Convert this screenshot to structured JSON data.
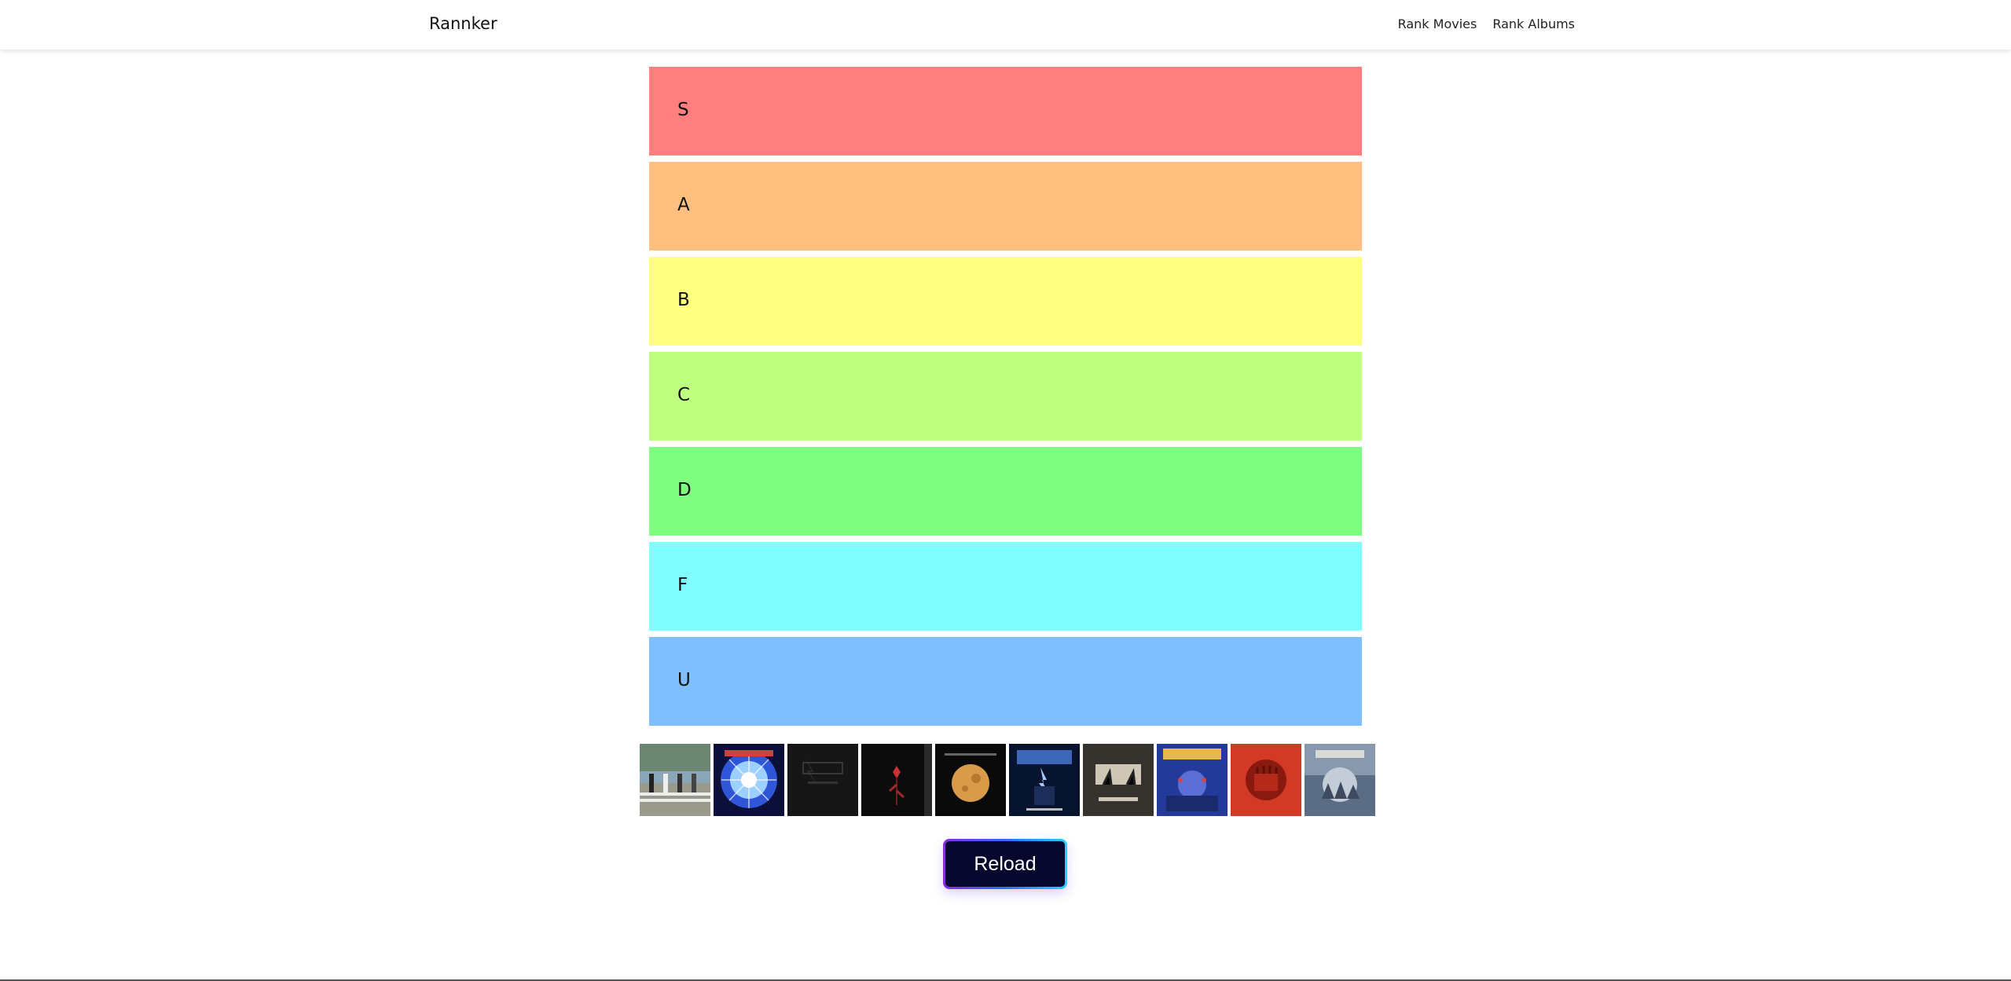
{
  "app": {
    "brand": "Rannker"
  },
  "nav": {
    "links": [
      "Rank Movies",
      "Rank Albums"
    ]
  },
  "tiers": [
    {
      "label": "S",
      "color": "#ff7f7f"
    },
    {
      "label": "A",
      "color": "#ffbf7f"
    },
    {
      "label": "B",
      "color": "#ffff7f"
    },
    {
      "label": "C",
      "color": "#bfff7f"
    },
    {
      "label": "D",
      "color": "#7fff7f"
    },
    {
      "label": "F",
      "color": "#7fffff"
    },
    {
      "label": "U",
      "color": "#7fbfff"
    }
  ],
  "album_pool": [
    {
      "icon": "album-cover-crosswalk"
    },
    {
      "icon": "album-cover-blue-sphere"
    },
    {
      "icon": "album-cover-black-logo"
    },
    {
      "icon": "album-cover-red-rose"
    },
    {
      "icon": "album-cover-orange-moon"
    },
    {
      "icon": "album-cover-blue-lightning"
    },
    {
      "icon": "album-cover-acdc-gray"
    },
    {
      "icon": "album-cover-megadeth-blue"
    },
    {
      "icon": "album-cover-red-fist"
    },
    {
      "icon": "album-cover-skyline-gray"
    }
  ],
  "reload": {
    "label": "Reload"
  }
}
